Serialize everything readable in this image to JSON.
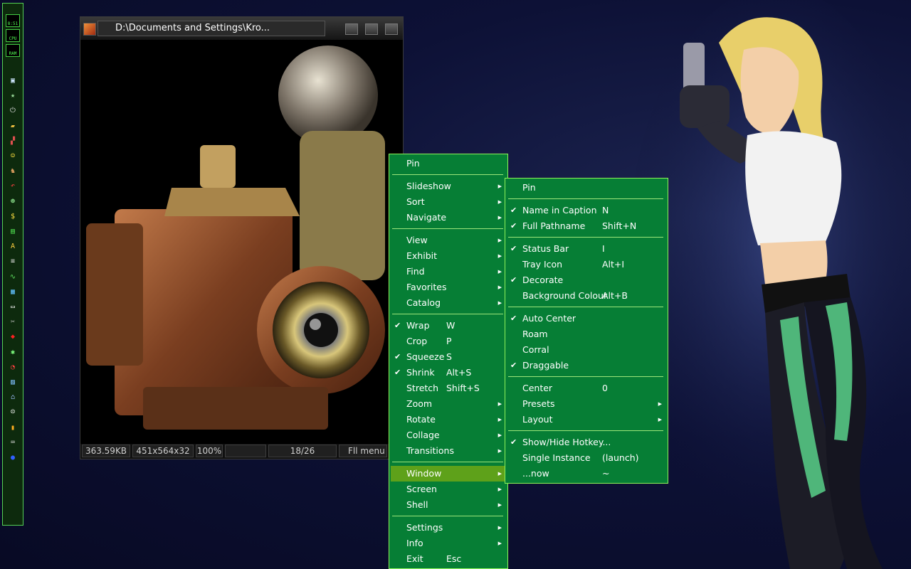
{
  "dock": {
    "clock": "8:51",
    "gauges": [
      {
        "label": "CPU"
      },
      {
        "label": "RAM"
      }
    ],
    "icons": [
      {
        "name": "display-icon",
        "glyph": "▣",
        "color": "#cfe7ff"
      },
      {
        "name": "start-icon",
        "glyph": "★",
        "color": "#9fe29f"
      },
      {
        "name": "power-icon",
        "glyph": "⏻",
        "color": "#dddddd"
      },
      {
        "name": "folder-icon",
        "glyph": "▰",
        "color": "#f0c040"
      },
      {
        "name": "flag-icon",
        "glyph": "▞",
        "color": "#e05050"
      },
      {
        "name": "smiley-icon",
        "glyph": "☺",
        "color": "#ffe040"
      },
      {
        "name": "search-person-icon",
        "glyph": "♞",
        "color": "#e0a060"
      },
      {
        "name": "undo-icon",
        "glyph": "↶",
        "color": "#ff4040"
      },
      {
        "name": "alien-icon",
        "glyph": "☻",
        "color": "#80d080"
      },
      {
        "name": "dollar-icon",
        "glyph": "$",
        "color": "#ffe040"
      },
      {
        "name": "film-icon",
        "glyph": "▤",
        "color": "#50e050"
      },
      {
        "name": "font-icon",
        "glyph": "A",
        "color": "#ffd040"
      },
      {
        "name": "binary-icon",
        "glyph": "≡",
        "color": "#dddddd"
      },
      {
        "name": "wave-icon",
        "glyph": "∿",
        "color": "#60e060"
      },
      {
        "name": "chart-icon",
        "glyph": "▦",
        "color": "#60c0ff"
      },
      {
        "name": "window-icon",
        "glyph": "▭",
        "color": "#ffffff"
      },
      {
        "name": "tools-icon",
        "glyph": "✂",
        "color": "#c0c0c0"
      },
      {
        "name": "diamond-icon",
        "glyph": "◆",
        "color": "#ff2020"
      },
      {
        "name": "bug-icon",
        "glyph": "✱",
        "color": "#80ff80"
      },
      {
        "name": "radar-icon",
        "glyph": "◔",
        "color": "#ff4040"
      },
      {
        "name": "map-icon",
        "glyph": "▨",
        "color": "#80c0ff"
      },
      {
        "name": "network-icon",
        "glyph": "⌂",
        "color": "#a0c0ff"
      },
      {
        "name": "face-icon",
        "glyph": "☹",
        "color": "#ffffff"
      },
      {
        "name": "bar-chart-icon",
        "glyph": "▮",
        "color": "#ffb020"
      },
      {
        "name": "keyboard-icon",
        "glyph": "⌨",
        "color": "#dddddd"
      },
      {
        "name": "globe-icon",
        "glyph": "●",
        "color": "#3060ff"
      }
    ]
  },
  "viewer": {
    "title": "D:\\Documents and Settings\\Kro...",
    "status": [
      "363.59KB",
      "451x564x32",
      "100%",
      "",
      "18/26",
      "Fll  menu"
    ]
  },
  "main_menu": {
    "items": [
      {
        "label": "Pin",
        "hotkey": "",
        "check": false,
        "arrow": false,
        "sep_after": true
      },
      {
        "label": "Slideshow",
        "hotkey": "",
        "check": false,
        "arrow": true,
        "sep_after": false
      },
      {
        "label": "Sort",
        "hotkey": "",
        "check": false,
        "arrow": true,
        "sep_after": false
      },
      {
        "label": "Navigate",
        "hotkey": "",
        "check": false,
        "arrow": true,
        "sep_after": true
      },
      {
        "label": "View",
        "hotkey": "",
        "check": false,
        "arrow": true,
        "sep_after": false
      },
      {
        "label": "Exhibit",
        "hotkey": "",
        "check": false,
        "arrow": true,
        "sep_after": false
      },
      {
        "label": "Find",
        "hotkey": "",
        "check": false,
        "arrow": true,
        "sep_after": false
      },
      {
        "label": "Favorites",
        "hotkey": "",
        "check": false,
        "arrow": true,
        "sep_after": false
      },
      {
        "label": "Catalog",
        "hotkey": "",
        "check": false,
        "arrow": true,
        "sep_after": true
      },
      {
        "label": "Wrap",
        "hotkey": "W",
        "check": true,
        "arrow": false,
        "sep_after": false
      },
      {
        "label": "Crop",
        "hotkey": "P",
        "check": false,
        "arrow": false,
        "sep_after": false
      },
      {
        "label": "Squeeze",
        "hotkey": "S",
        "check": true,
        "arrow": false,
        "sep_after": false
      },
      {
        "label": "Shrink",
        "hotkey": "Alt+S",
        "check": true,
        "arrow": false,
        "sep_after": false
      },
      {
        "label": "Stretch",
        "hotkey": "Shift+S",
        "check": false,
        "arrow": false,
        "sep_after": false
      },
      {
        "label": "Zoom",
        "hotkey": "",
        "check": false,
        "arrow": true,
        "sep_after": false
      },
      {
        "label": "Rotate",
        "hotkey": "",
        "check": false,
        "arrow": true,
        "sep_after": false
      },
      {
        "label": "Collage",
        "hotkey": "",
        "check": false,
        "arrow": true,
        "sep_after": false
      },
      {
        "label": "Transitions",
        "hotkey": "",
        "check": false,
        "arrow": true,
        "sep_after": true
      },
      {
        "label": "Window",
        "hotkey": "",
        "check": false,
        "arrow": true,
        "sep_after": false,
        "highlight": true
      },
      {
        "label": "Screen",
        "hotkey": "",
        "check": false,
        "arrow": true,
        "sep_after": false
      },
      {
        "label": "Shell",
        "hotkey": "",
        "check": false,
        "arrow": true,
        "sep_after": true
      },
      {
        "label": "Settings",
        "hotkey": "",
        "check": false,
        "arrow": true,
        "sep_after": false
      },
      {
        "label": "Info",
        "hotkey": "",
        "check": false,
        "arrow": true,
        "sep_after": false
      },
      {
        "label": "Exit",
        "hotkey": "Esc",
        "check": false,
        "arrow": false,
        "sep_after": false
      }
    ]
  },
  "window_menu": {
    "items": [
      {
        "label": "Pin",
        "hotkey": "",
        "check": false,
        "arrow": false,
        "sep_after": true
      },
      {
        "label": "Name in Caption",
        "hotkey": "N",
        "check": true,
        "arrow": false,
        "sep_after": false
      },
      {
        "label": "Full Pathname",
        "hotkey": "Shift+N",
        "check": true,
        "arrow": false,
        "sep_after": true
      },
      {
        "label": "Status Bar",
        "hotkey": "I",
        "check": true,
        "arrow": false,
        "sep_after": false
      },
      {
        "label": "Tray Icon",
        "hotkey": "Alt+I",
        "check": false,
        "arrow": false,
        "sep_after": false
      },
      {
        "label": "Decorate",
        "hotkey": "",
        "check": true,
        "arrow": false,
        "sep_after": false
      },
      {
        "label": "Background Colour",
        "hotkey": "Alt+B",
        "check": false,
        "arrow": false,
        "sep_after": true
      },
      {
        "label": "Auto Center",
        "hotkey": "",
        "check": true,
        "arrow": false,
        "sep_after": false
      },
      {
        "label": "Roam",
        "hotkey": "",
        "check": false,
        "arrow": false,
        "sep_after": false
      },
      {
        "label": "Corral",
        "hotkey": "",
        "check": false,
        "arrow": false,
        "sep_after": false
      },
      {
        "label": "Draggable",
        "hotkey": "",
        "check": true,
        "arrow": false,
        "sep_after": true
      },
      {
        "label": "Center",
        "hotkey": "0",
        "check": false,
        "arrow": false,
        "sep_after": false
      },
      {
        "label": "Presets",
        "hotkey": "",
        "check": false,
        "arrow": true,
        "sep_after": false
      },
      {
        "label": "Layout",
        "hotkey": "",
        "check": false,
        "arrow": true,
        "sep_after": true
      },
      {
        "label": "Show/Hide Hotkey...",
        "hotkey": "",
        "check": true,
        "arrow": false,
        "sep_after": false
      },
      {
        "label": "Single Instance",
        "hotkey": "(launch)",
        "check": false,
        "arrow": false,
        "sep_after": false
      },
      {
        "label": "...now",
        "hotkey": "~",
        "check": false,
        "arrow": false,
        "sep_after": false
      }
    ]
  }
}
